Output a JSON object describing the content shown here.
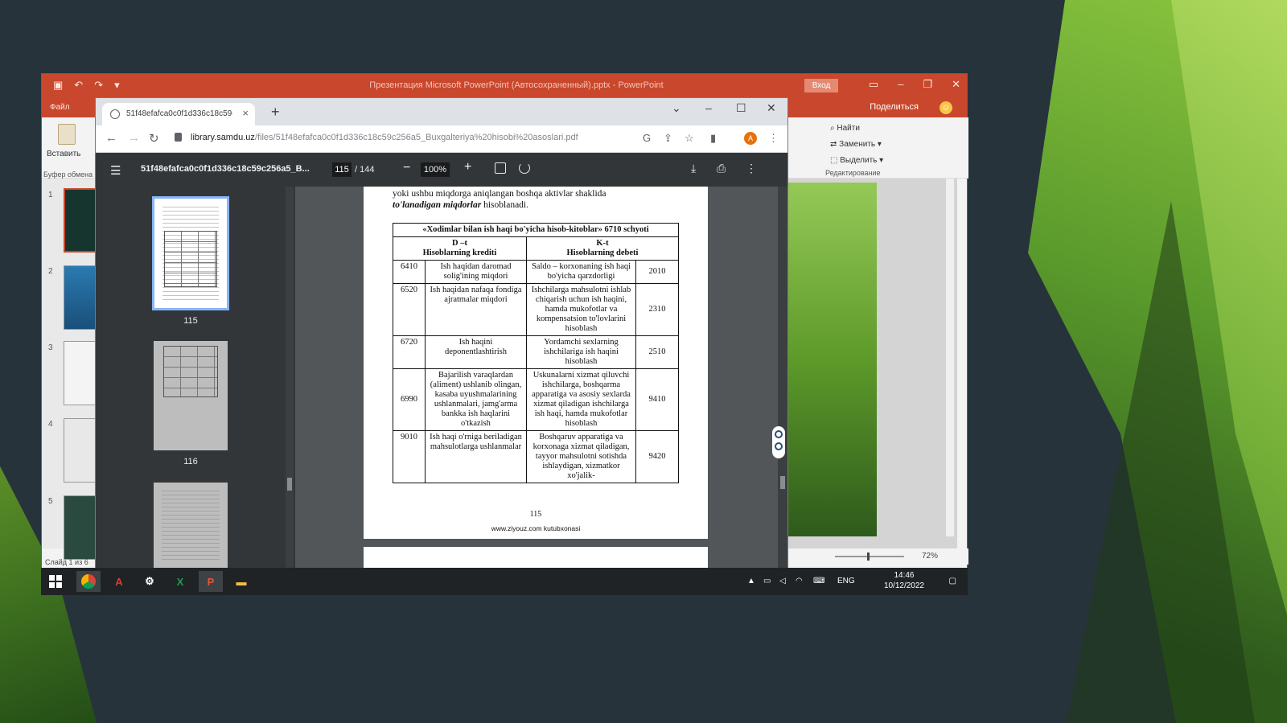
{
  "powerpoint": {
    "title": "Презентация Microsoft PowerPoint (Автосохраненный).pptx - PowerPoint",
    "login_button": "Вход",
    "file_tab": "Файл",
    "share_button": "Поделиться",
    "paste_label": "Вставить",
    "clipboard_group": "Буфер обмена",
    "find_label": "Найти",
    "replace_label": "Заменить",
    "select_label": "Выделить",
    "editing_group": "Редактирование",
    "slide_numbers": [
      "1",
      "2",
      "3",
      "4",
      "5"
    ],
    "slide_status": "Слайд 1 из 6",
    "zoom_level": "72%"
  },
  "chrome": {
    "tab_title": "51f48efafca0c0f1d336c18c59c2...",
    "url_host": "library.samdu.uz",
    "url_path": "/files/51f48efafca0c0f1d336c18c59c256a5_Buxgalteriya%20hisobi%20asoslari.pdf",
    "profile_initial": "A"
  },
  "pdf": {
    "file_title": "51f48efafca0c0f1d336c18c59c256a5_B...",
    "current_page": "115",
    "total_pages": "/ 144",
    "zoom": "100%",
    "thumbnails": [
      {
        "label": "115"
      },
      {
        "label": "116"
      },
      {
        "label": ""
      }
    ],
    "page_text_line1": "yoki ushbu miqdorga aniqlangan boshqa aktivlar shaklida",
    "page_text_emph": "to'lanadigan miqdorlar",
    "page_text_tail": "hisoblanadi.",
    "table": {
      "title": "«Xodimlar bilan ish haqi bo'yicha hisob-kitoblar» 6710 schyoti",
      "col_debit_head": "D –t",
      "col_debit_sub": "Hisoblarning krediti",
      "col_credit_head": "K-t",
      "col_credit_sub": "Hisoblarning debeti",
      "rows": [
        {
          "acc_d": "6410",
          "desc_d": "Ish haqidan daromad solig'ining miqdori",
          "desc_k": "Saldo – korxonaning ish haqi bo'yicha qarzdorligi",
          "acc_k": "2010"
        },
        {
          "acc_d": "6520",
          "desc_d": "Ish haqidan nafaqa fondiga ajratmalar miqdori",
          "desc_k": "Ishchilarga mahsulotni ishlab chiqarish uchun ish haqini, hamda mukofotlar va kompensatsion to'lovlarini hisoblash",
          "acc_k": "2310"
        },
        {
          "acc_d": "6720",
          "desc_d": "Ish haqini deponentlashtirish",
          "desc_k": "Yordamchi sexlarning ishchilariga ish haqini hisoblash",
          "acc_k": "2510"
        },
        {
          "acc_d": "6990",
          "desc_d": "Bajarilish varaqlardan (aliment) ushlanib olingan, kasaba uyushmalarining ushlanmalari, jamg'arma bankka ish haqlarini o'tkazish",
          "desc_k": "Uskunalarni xizmat qiluvchi ishchilarga, boshqarma apparatiga va asosiy sexlarda xizmat qiladigan ishchilarga ish haqi, hamda mukofotlar hisoblash",
          "acc_k": "9410"
        },
        {
          "acc_d": "9010",
          "desc_d": "Ish haqi o'rniga beriladigan mahsulotlarga ushlanmalar",
          "desc_k": "Boshqaruv apparatiga va korxonaga xizmat qiladigan, tayyor mahsulotni sotishda ishlaydigan, xizmatkor xo'jalik-",
          "acc_k": "9420"
        }
      ]
    },
    "page_number": "115",
    "footer": "www.ziyouz.com kutubxonasi"
  },
  "taskbar": {
    "apps": [
      "chrome",
      "acrobat",
      "settings",
      "excel",
      "powerpoint",
      "explorer"
    ],
    "language": "ENG",
    "time": "14:46",
    "date": "10/12/2022"
  }
}
